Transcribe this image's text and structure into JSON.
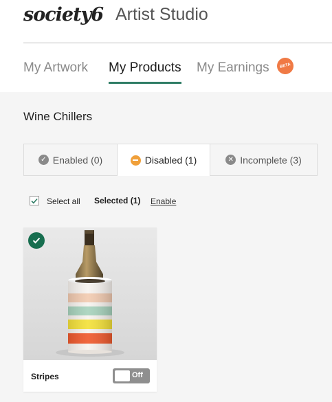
{
  "header": {
    "logo": "society6",
    "app_title": "Artist Studio"
  },
  "nav": {
    "tabs": [
      {
        "label": "My Artwork"
      },
      {
        "label": "My Products"
      },
      {
        "label": "My Earnings"
      }
    ],
    "active_tab": "My Products",
    "beta_badge": "BETA"
  },
  "section": {
    "title": "Wine Chillers"
  },
  "filters": [
    {
      "label": "Enabled (0)",
      "icon": "check-circle-icon"
    },
    {
      "label": "Disabled (1)",
      "icon": "minus-circle-icon"
    },
    {
      "label": "Incomplete (3)",
      "icon": "x-circle-icon"
    }
  ],
  "active_filter": "Disabled (1)",
  "selection": {
    "select_all_label": "Select all",
    "selected_text": "Selected (1)",
    "enable_link": "Enable"
  },
  "products": [
    {
      "name": "Stripes",
      "toggle_label": "Off",
      "selected": true,
      "stripe_colors": [
        "#f2cbb1",
        "#a8d3bd",
        "#f4e13a",
        "#ef5a2e"
      ]
    }
  ],
  "colors": {
    "accent": "#2f7d65",
    "check_badge": "#176e4f",
    "disabled_icon": "#f0a03a",
    "beta": "#f07a45"
  }
}
